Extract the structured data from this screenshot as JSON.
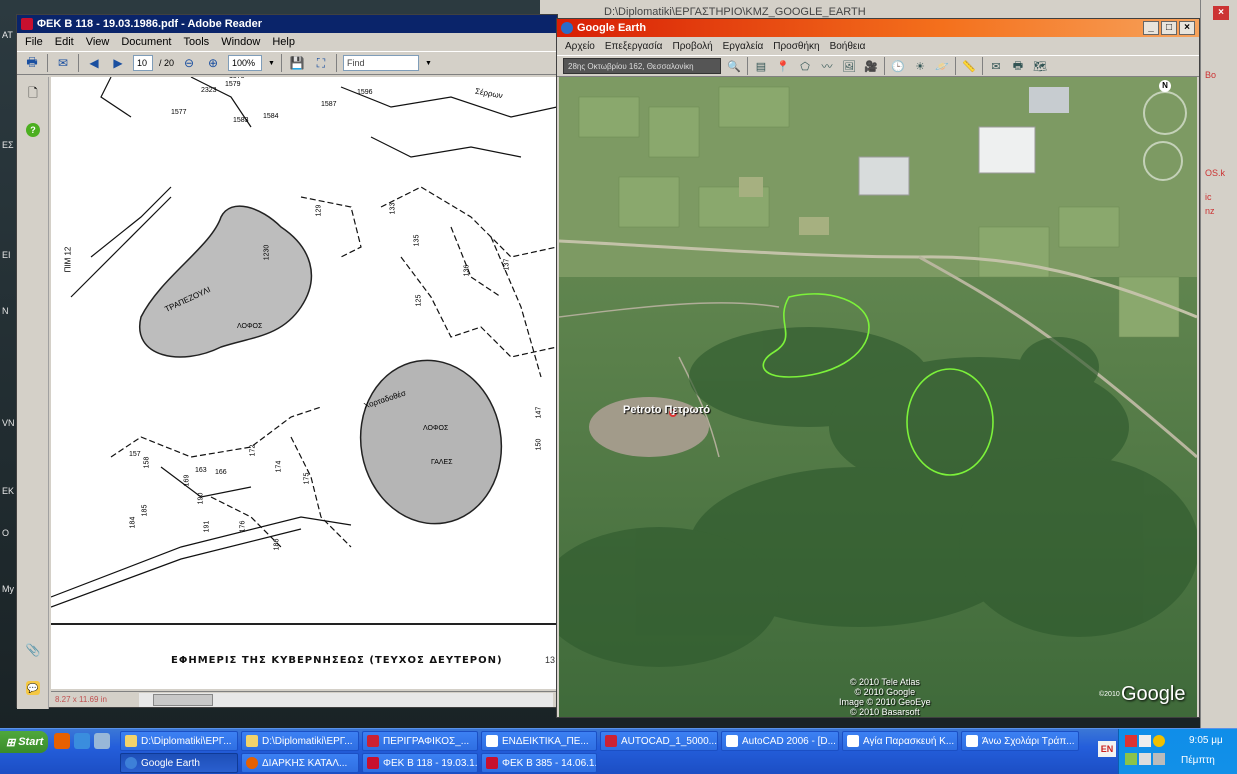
{
  "desktop": {
    "labels": [
      "ΑΤ",
      "ΕΣ",
      "ΕΙ",
      "Ν",
      "VN",
      "ΕΚ",
      "Ο",
      "My"
    ]
  },
  "bg_window": {
    "title": "D:\\Diplomatiki\\ΕΡΓΑΣΤΗΡΙΟ\\KMZ_GOOGLE_EARTH"
  },
  "reader": {
    "title": "ΦΕΚ Β 118 - 19.03.1986.pdf - Adobe Reader",
    "menu": [
      "File",
      "Edit",
      "View",
      "Document",
      "Tools",
      "Window",
      "Help"
    ],
    "page_current": "10",
    "page_total": "/ 20",
    "zoom": "100%",
    "find_placeholder": "Find",
    "page_size": "8.27 x 11.69 in",
    "footer_text": "ΕΦΗΜΕΡΙΣ ΤΗΣ ΚΥΒΕΡΝΗΣΕΩΣ (ΤΕΥΧΟΣ ΔΕΥΤΕΡΟΝ)",
    "footer_page": "13",
    "map_labels": {
      "road": "ΠΙΜ 12",
      "road_right": "Σέρρων",
      "area1_a": "ΤΡΑΠΕΖΟΥΛΙ",
      "area1_b": "ΛΟΦΟΣ",
      "area2_a": "Χορταδοθέσ",
      "area2_b": "ΛΟΦΟΣ",
      "area2_c": "ΓΑΛΕΣ",
      "parcels": [
        "1577",
        "2323",
        "1579",
        "1578",
        "1583",
        "1584",
        "1587",
        "1596",
        "129",
        "133",
        "135",
        "136",
        "137",
        "125",
        "1230",
        "157",
        "158",
        "163",
        "166",
        "169",
        "172",
        "174",
        "175",
        "176",
        "186",
        "190",
        "191",
        "185",
        "184",
        "147",
        "150"
      ]
    }
  },
  "earth": {
    "title": "Google Earth",
    "menu": [
      "Αρχείο",
      "Επεξεργασία",
      "Προβολή",
      "Εργαλεία",
      "Προσθήκη",
      "Βοήθεια"
    ],
    "search_value": "28ης Οκτωβρίου 162, Θεσσαλονίκη",
    "place_label": "Petroto Πετρωτό",
    "compass": "N",
    "credits": [
      "© 2010 Tele Atlas",
      "© 2010 Google",
      "Image © 2010 GeoEye",
      "© 2010 Basarsoft"
    ],
    "logo": "Google",
    "logo_small": "©2010"
  },
  "right_strip": {
    "snippets": [
      "Βο",
      "OS.k",
      "ic",
      "nz"
    ]
  },
  "taskbar": {
    "start": "Start",
    "tasks_row1": [
      "D:\\Diplomatiki\\ΕΡΓ...",
      "D:\\Diplomatiki\\ΕΡΓ...",
      "ΠΕΡΙΓΡΑΦΙΚΟΣ_...",
      "ΕΝΔΕΙΚΤΙΚΑ_ΠΕ...",
      "AUTOCAD_1_5000...",
      "AutoCAD 2006 - [D...",
      "Αγία Παρασκευή Κ...",
      "Άνω Σχολάρι Τράπ..."
    ],
    "tasks_row2": [
      "Google Earth",
      "ΔΙΑΡΚΗΣ ΚΑΤΑΛ...",
      "ΦΕΚ Β 118 - 19.03.1...",
      "ΦΕΚ Β 385 - 14.06.1..."
    ],
    "lang": "EN",
    "time": "9:05 μμ",
    "day": "Πέμπτη"
  },
  "colors": {
    "reader_title": "#0a246a",
    "earth_title": "#e0401a",
    "taskbar": "#245edb",
    "boundary": "#7cf23a"
  }
}
